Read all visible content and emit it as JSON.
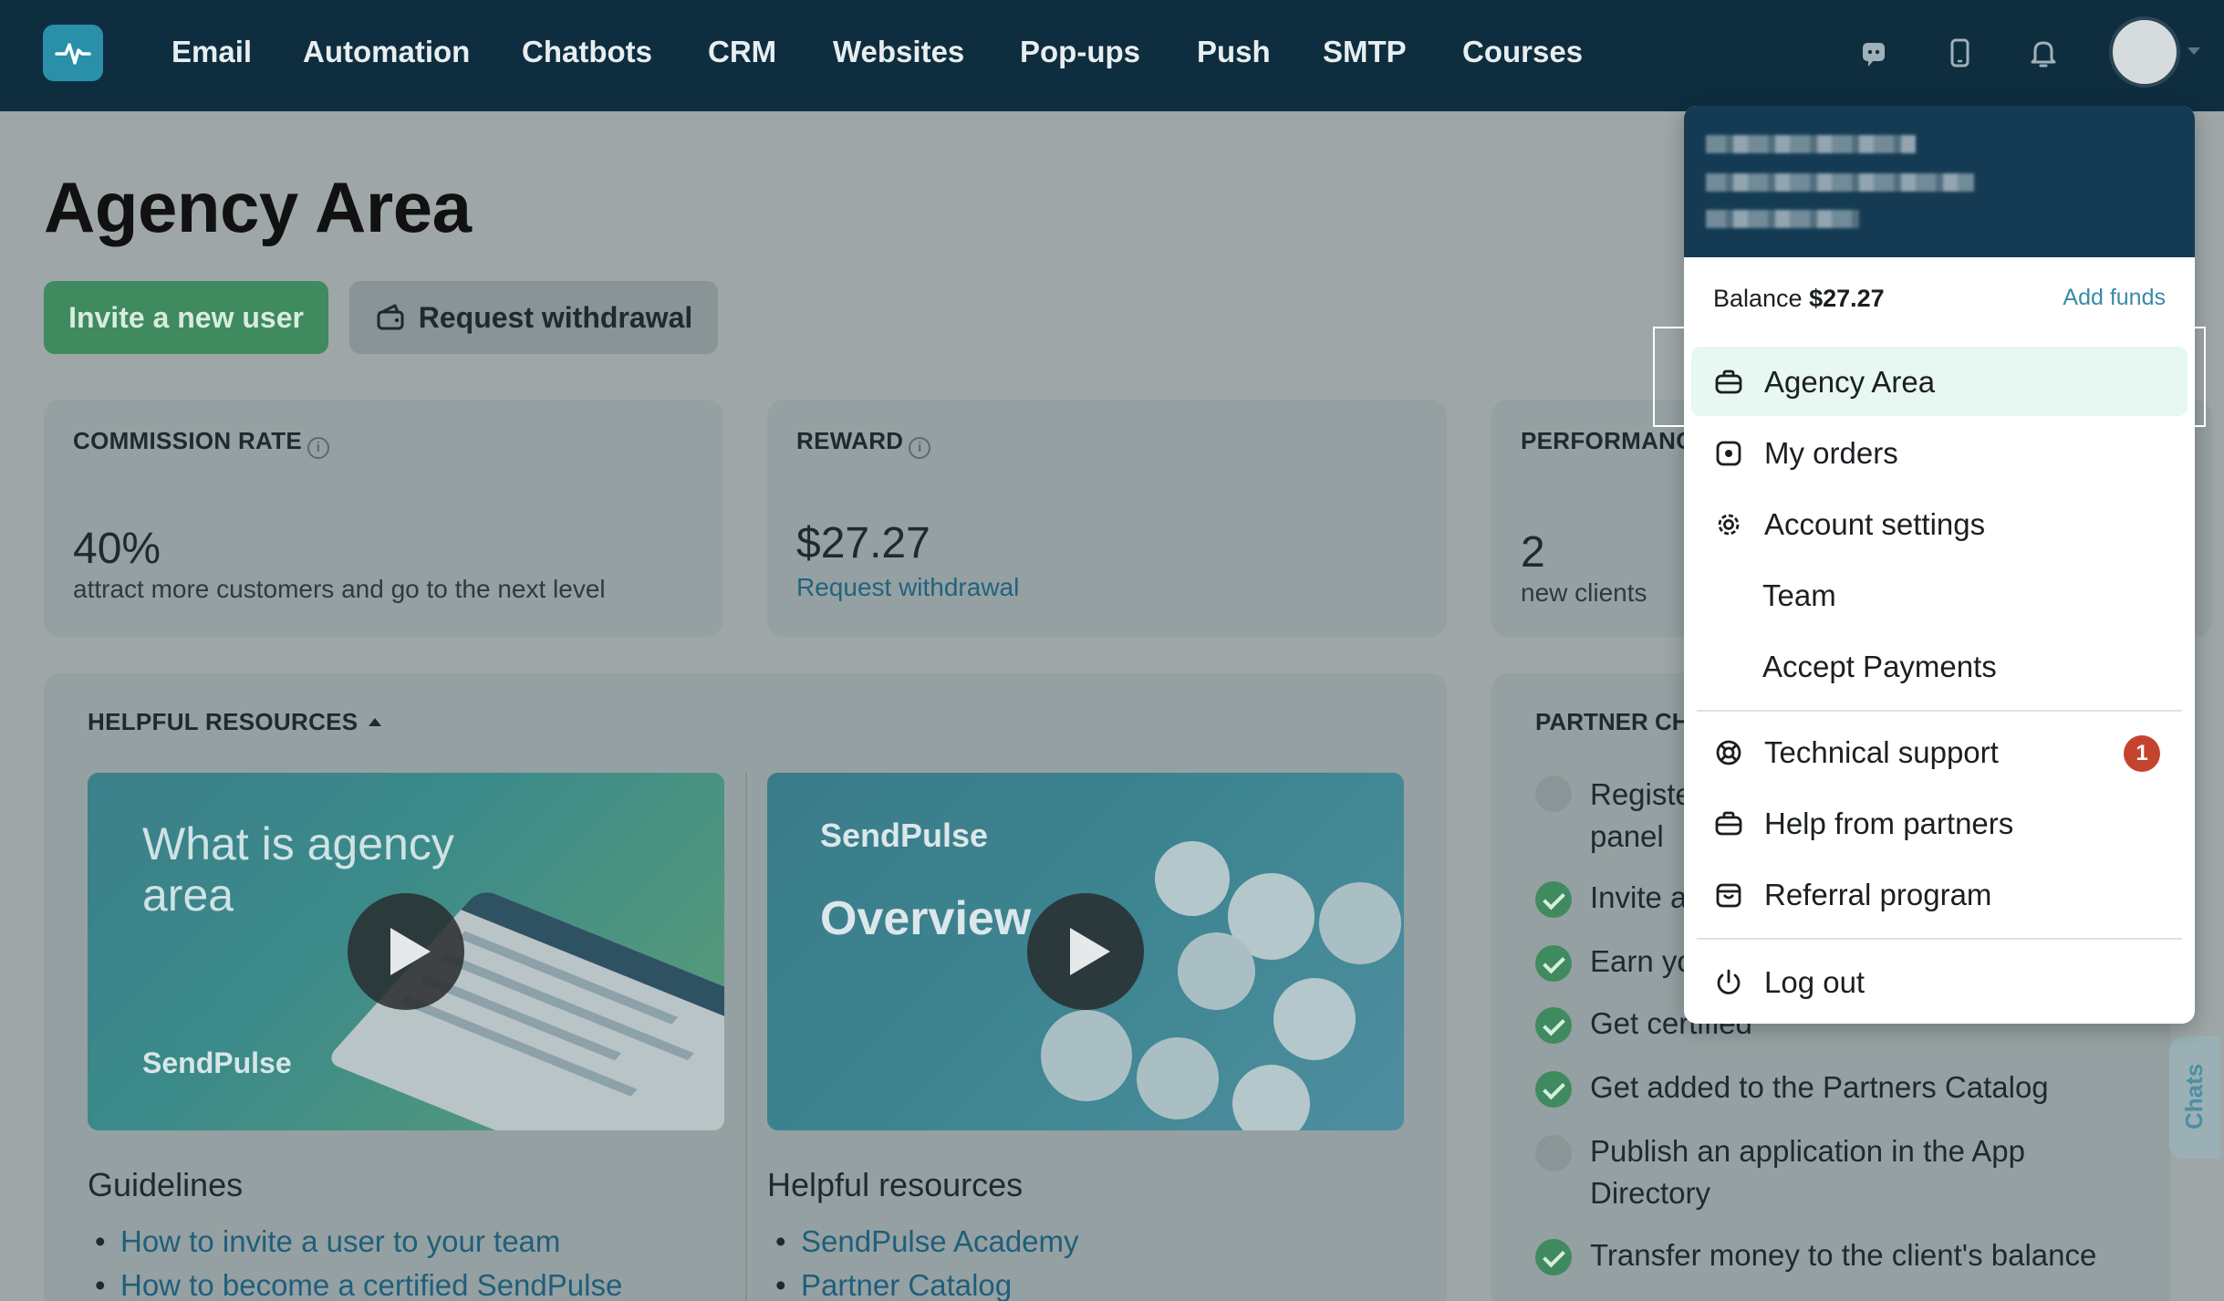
{
  "nav": {
    "items": [
      "Email",
      "Automation",
      "Chatbots",
      "CRM",
      "Websites",
      "Pop-ups",
      "Push",
      "SMTP",
      "Courses"
    ],
    "icons": [
      "chat-icon",
      "phone-icon",
      "bell-icon"
    ]
  },
  "page": {
    "title": "Agency Area",
    "invite_button": "Invite a new user",
    "withdraw_button": "Request withdrawal"
  },
  "stats": {
    "commission": {
      "label": "COMMISSION RATE",
      "value": "40%",
      "sub": "attract more customers and go to the next level"
    },
    "reward": {
      "label": "REWARD",
      "value": "$27.27",
      "link": "Request withdrawal"
    },
    "performance": {
      "label": "PERFORMANC",
      "value": "2",
      "sub": "new clients"
    }
  },
  "resources": {
    "title": "HELPFUL RESOURCES",
    "video1": {
      "line1": "What is agency",
      "line2": "area",
      "brand": "SendPulse"
    },
    "video2": {
      "brand": "SendPulse",
      "title": "Overview"
    },
    "guidelines_title": "Guidelines",
    "guidelines": [
      "How to invite a user to your team",
      "How to become a certified SendPulse"
    ],
    "helpful_title": "Helpful resources",
    "helpful": [
      "SendPulse Academy",
      "Partner Catalog"
    ]
  },
  "partner": {
    "title": "PARTNER CH",
    "steps": [
      {
        "text": "Registe",
        "text2": "panel",
        "done": false
      },
      {
        "text": "Invite a",
        "done": true
      },
      {
        "text": "Earn yo",
        "done": true
      },
      {
        "text": "Get certified",
        "done": true
      },
      {
        "text": "Get added to the Partners Catalog",
        "done": true
      },
      {
        "text": "Publish an application in the App",
        "text2": "Directory",
        "done": false
      },
      {
        "text": "Transfer money to the client's balance",
        "done": true
      }
    ]
  },
  "chats_tab": "Chats",
  "dropdown": {
    "balance_label": "Balance",
    "balance_value": "$27.27",
    "add_funds": "Add funds",
    "items": [
      {
        "label": "Agency Area",
        "icon": "briefcase-icon"
      },
      {
        "label": "My orders",
        "icon": "orders-icon"
      },
      {
        "label": "Account settings",
        "icon": "gear-icon"
      },
      {
        "label": "Team",
        "icon": ""
      },
      {
        "label": "Accept Payments",
        "icon": ""
      },
      {
        "label": "Technical support",
        "icon": "lifebuoy-icon",
        "badge": "1"
      },
      {
        "label": "Help from partners",
        "icon": "briefcase-icon"
      },
      {
        "label": "Referral program",
        "icon": "gift-icon"
      },
      {
        "label": "Log out",
        "icon": "power-icon"
      }
    ]
  },
  "colors": {
    "nav_bg": "#0e2e3f",
    "accent_green": "#3f8a5f",
    "link": "#21637d",
    "badge": "#c4432f"
  }
}
